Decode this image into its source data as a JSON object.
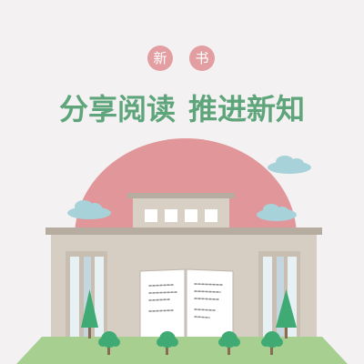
{
  "badges": [
    "新",
    "书"
  ],
  "headline": {
    "part1": "分享阅读",
    "part2": "推进新知"
  },
  "colors": {
    "background": "#f3f1f2",
    "headline_green": "#5fa57b",
    "badge_pink": "#e39ea1",
    "dome_pink": "#e19699",
    "cloud_blue": "#a8d2da",
    "building_beige": "#d7cec3",
    "roof_brown": "#b7aca0",
    "tree_green": "#3faa73",
    "grass_green": "#a7cf8f"
  },
  "icons": [
    "cloud-icon",
    "tree-icon",
    "bush-icon",
    "open-book-icon",
    "window-icon"
  ]
}
